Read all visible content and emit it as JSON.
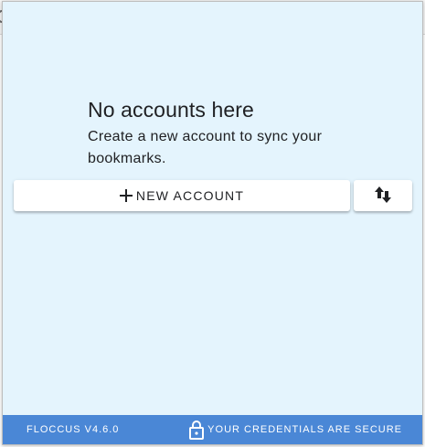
{
  "empty_state": {
    "title": "No accounts here",
    "description": "Create a new account to sync your bookmarks."
  },
  "actions": {
    "new_account_label": "NEW ACCOUNT",
    "new_account_icon": "plus-icon",
    "sync_icon": "swap-vertical-icon"
  },
  "footer": {
    "version": "FLOCCUS V4.6.0",
    "secure_label": "YOUR CREDENTIALS ARE SECURE",
    "secure_icon": "lock-icon"
  },
  "colors": {
    "background": "#e4f4fd",
    "footer_bg": "#4a87d6",
    "button_bg": "#ffffff",
    "text": "#202124"
  }
}
